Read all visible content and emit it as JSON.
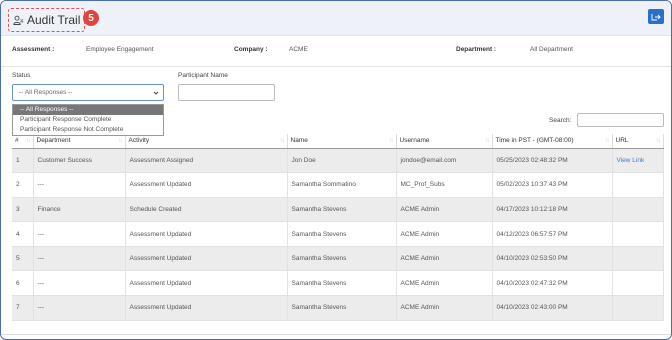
{
  "header": {
    "title": "Audit Trail",
    "step_badge": "5",
    "export_icon": "export-icon"
  },
  "info": {
    "assessment_label": "Assessment :",
    "assessment_value": "Employee Engagement",
    "company_label": "Company :",
    "company_value": "ACME",
    "department_label": "Department :",
    "department_value": "All Department"
  },
  "filters": {
    "status_label": "Status",
    "status_selected": "-- All Responses --",
    "status_options": [
      "-- All Responses --",
      "Participant Response Complete",
      "Participant Response Not Complete"
    ],
    "participant_label": "Participant Name",
    "participant_value": ""
  },
  "search": {
    "label": "Search:",
    "value": ""
  },
  "table": {
    "headers": [
      "#",
      "Department",
      "Activity",
      "Name",
      "Username",
      "Time in PST - (GMT-08:00)",
      "URL"
    ],
    "rows": [
      [
        "1",
        "Customer Success",
        "Assessment Assigned",
        "Jon Doe",
        "jondoe@email.com",
        "05/25/2023 02:48:32 PM",
        "View Link"
      ],
      [
        "2",
        "---",
        "Assessment Updated",
        "Samantha Sommatino",
        "MC_Prof_Subs",
        "05/02/2023 10:37:43 PM",
        ""
      ],
      [
        "3",
        "Finance",
        "Schedule Created",
        "Samantha Stevens",
        "ACME Admin",
        "04/17/2023 10:12:18 PM",
        ""
      ],
      [
        "4",
        "---",
        "Assessment Updated",
        "Samantha Stevens",
        "ACME Admin",
        "04/12/2023 06:57:57 PM",
        ""
      ],
      [
        "5",
        "---",
        "Assessment Updated",
        "Samantha Stevens",
        "ACME Admin",
        "04/10/2023 02:53:50 PM",
        ""
      ],
      [
        "6",
        "---",
        "Assessment Updated",
        "Samantha Stevens",
        "ACME Admin",
        "04/10/2023 02:47:32 PM",
        ""
      ],
      [
        "7",
        "---",
        "Assessment Updated",
        "Samantha Stevens",
        "ACME Admin",
        "04/10/2023 02:43:00 PM",
        ""
      ]
    ]
  },
  "colors": {
    "accent": "#2a6fc9",
    "badge": "#e0443a",
    "link": "#3c7ad6",
    "header_bg": "#eef2f8"
  }
}
